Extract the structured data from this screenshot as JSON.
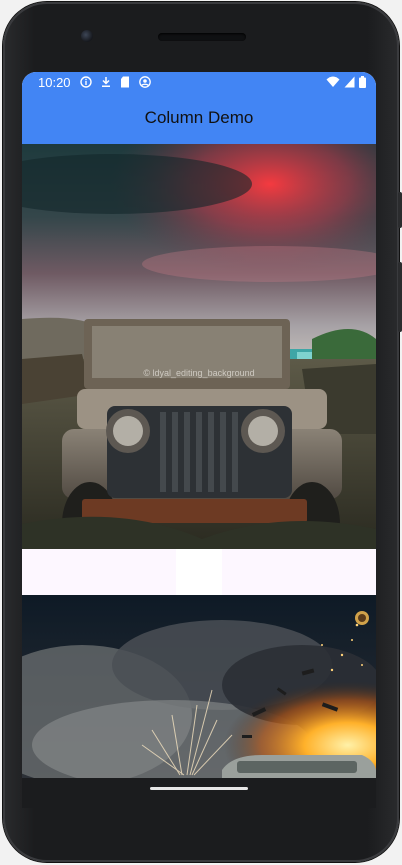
{
  "status_bar": {
    "time": "10:20",
    "icons_left": [
      "info-icon",
      "download-icon",
      "sd-card-icon",
      "account-circle-icon"
    ],
    "icons_right": [
      "wifi-icon",
      "cell-signal-icon",
      "battery-icon"
    ]
  },
  "app_bar": {
    "title": "Column Demo",
    "color": "#4285f4"
  },
  "images": {
    "first": {
      "watermark": "© ldyal_editing_background",
      "subject": "old jeep under red sunset sky"
    },
    "second": {
      "subject": "explosion with debris and smoke behind car"
    }
  },
  "colors": {
    "spacer": "#fdf7ff",
    "nav_bar": "#1b1c1e"
  }
}
